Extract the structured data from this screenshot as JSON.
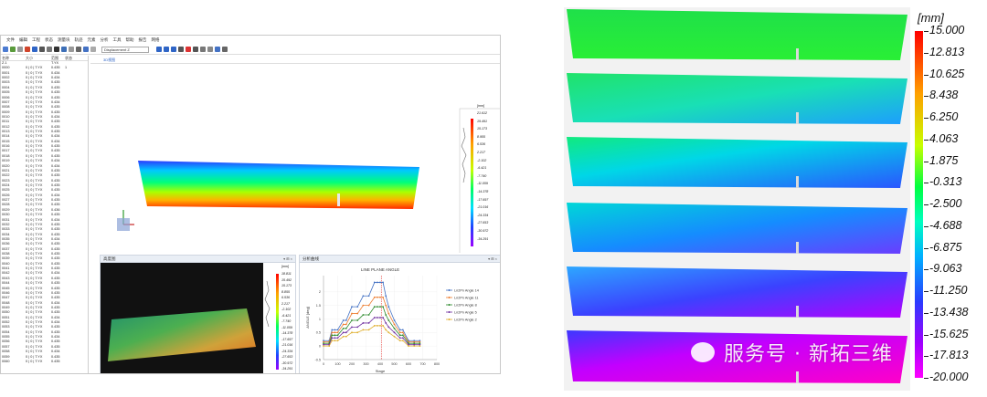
{
  "menu": [
    "文件",
    "编辑",
    "工程",
    "状态",
    "测量块",
    "轨迹",
    "元素",
    "分析",
    "工具",
    "帮助",
    "报告",
    "网络"
  ],
  "toolbar": {
    "display_mode": "Displacement Z"
  },
  "view_tab": "3D视图",
  "tree": {
    "headers": [
      "名称",
      "大小",
      "范围",
      "状态"
    ],
    "rows": [
      [
        "Z.1",
        "",
        "T.YX",
        ""
      ],
      [
        "0000",
        "0 | 0 | T.YX",
        "0.435",
        "1"
      ],
      [
        "0001",
        "0 | 0 | T.YX",
        "0.434",
        ""
      ],
      [
        "0002",
        "0 | 0 | T.YX",
        "0.434",
        ""
      ],
      [
        "0003",
        "0 | 0 | T.YX",
        "0.435",
        ""
      ],
      [
        "0004",
        "0 | 0 | T.YX",
        "0.435",
        ""
      ],
      [
        "0005",
        "0 | 0 | T.YX",
        "0.435",
        ""
      ],
      [
        "0006",
        "0 | 0 | T.YX",
        "0.435",
        ""
      ],
      [
        "0007",
        "0 | 0 | T.YX",
        "0.434",
        ""
      ],
      [
        "0008",
        "0 | 0 | T.YX",
        "0.435",
        ""
      ],
      [
        "0009",
        "0 | 0 | T.YX",
        "0.435",
        ""
      ],
      [
        "0010",
        "0 | 0 | T.YX",
        "0.434",
        ""
      ],
      [
        "0011",
        "0 | 0 | T.YX",
        "0.435",
        ""
      ],
      [
        "0012",
        "0 | 0 | T.YX",
        "0.435",
        ""
      ],
      [
        "0013",
        "0 | 0 | T.YX",
        "0.435",
        ""
      ],
      [
        "0014",
        "0 | 0 | T.YX",
        "0.434",
        ""
      ],
      [
        "0015",
        "0 | 0 | T.YX",
        "0.434",
        ""
      ],
      [
        "0016",
        "0 | 0 | T.YX",
        "0.435",
        ""
      ],
      [
        "0017",
        "0 | 0 | T.YX",
        "0.435",
        ""
      ],
      [
        "0018",
        "0 | 0 | T.YX",
        "0.435",
        ""
      ],
      [
        "0019",
        "0 | 0 | T.YX",
        "0.434",
        ""
      ],
      [
        "0020",
        "0 | 0 | T.YX",
        "0.434",
        ""
      ],
      [
        "0021",
        "0 | 0 | T.YX",
        "0.435",
        ""
      ],
      [
        "0022",
        "0 | 0 | T.YX",
        "0.435",
        ""
      ],
      [
        "0023",
        "0 | 0 | T.YX",
        "0.435",
        ""
      ],
      [
        "0024",
        "0 | 0 | T.YX",
        "0.435",
        ""
      ],
      [
        "0025",
        "0 | 0 | T.YX",
        "0.435",
        ""
      ],
      [
        "0026",
        "0 | 0 | T.YX",
        "0.434",
        ""
      ],
      [
        "0027",
        "0 | 0 | T.YX",
        "0.435",
        ""
      ],
      [
        "0028",
        "0 | 0 | T.YX",
        "0.435",
        ""
      ],
      [
        "0029",
        "0 | 0 | T.YX",
        "0.436",
        ""
      ],
      [
        "0030",
        "0 | 0 | T.YX",
        "0.435",
        ""
      ],
      [
        "0031",
        "0 | 0 | T.YX",
        "0.434",
        ""
      ],
      [
        "0032",
        "0 | 0 | T.YX",
        "0.435",
        ""
      ],
      [
        "0033",
        "0 | 0 | T.YX",
        "0.435",
        ""
      ],
      [
        "0034",
        "0 | 0 | T.YX",
        "0.435",
        ""
      ],
      [
        "0035",
        "0 | 0 | T.YX",
        "0.434",
        ""
      ],
      [
        "0036",
        "0 | 0 | T.YX",
        "0.435",
        ""
      ],
      [
        "0037",
        "0 | 0 | T.YX",
        "0.435",
        ""
      ],
      [
        "0038",
        "0 | 0 | T.YX",
        "0.435",
        ""
      ],
      [
        "0039",
        "0 | 0 | T.YX",
        "0.435",
        ""
      ],
      [
        "0040",
        "0 | 0 | T.YX",
        "0.435",
        ""
      ],
      [
        "0041",
        "0 | 0 | T.YX",
        "0.435",
        ""
      ],
      [
        "0042",
        "0 | 0 | T.YX",
        "0.434",
        ""
      ],
      [
        "0043",
        "0 | 0 | T.YX",
        "0.435",
        ""
      ],
      [
        "0044",
        "0 | 0 | T.YX",
        "0.435",
        ""
      ],
      [
        "0045",
        "0 | 0 | T.YX",
        "0.435",
        ""
      ],
      [
        "0046",
        "0 | 0 | T.YX",
        "0.435",
        ""
      ],
      [
        "0047",
        "0 | 0 | T.YX",
        "0.435",
        ""
      ],
      [
        "0048",
        "0 | 0 | T.YX",
        "0.434",
        ""
      ],
      [
        "0049",
        "0 | 0 | T.YX",
        "0.435",
        ""
      ],
      [
        "0050",
        "0 | 0 | T.YX",
        "0.435",
        ""
      ],
      [
        "0051",
        "0 | 0 | T.YX",
        "0.434",
        ""
      ],
      [
        "0052",
        "0 | 0 | T.YX",
        "0.434",
        ""
      ],
      [
        "0053",
        "0 | 0 | T.YX",
        "0.435",
        ""
      ],
      [
        "0054",
        "0 | 0 | T.YX",
        "0.435",
        ""
      ],
      [
        "0055",
        "0 | 0 | T.YX",
        "0.434",
        ""
      ],
      [
        "0056",
        "0 | 0 | T.YX",
        "0.435",
        ""
      ],
      [
        "0057",
        "0 | 0 | T.YX",
        "0.435",
        ""
      ],
      [
        "0058",
        "0 | 0 | T.YX",
        "0.434",
        ""
      ],
      [
        "0059",
        "0 | 0 | T.YX",
        "0.435",
        ""
      ],
      [
        "0060",
        "0 | 0 | T.YX",
        "0.435",
        ""
      ]
    ]
  },
  "view_legend": {
    "unit": "[mm]",
    "ticks": [
      "21.612",
      "19.491",
      "15.173",
      "8.955",
      "6.536",
      "2.217",
      "-2.102",
      "-6.421",
      "-7.740",
      "-11.059",
      "-14.378",
      "-17.697",
      "-21.016",
      "-24.334",
      "-27.653",
      "-30.972",
      "-34.291"
    ]
  },
  "heightmap_panel": {
    "title": "高度图",
    "unit": "[mm]",
    "ticks": [
      "18.811",
      "15.492",
      "15.173",
      "8.855",
      "6.536",
      "2.217",
      "-2.102",
      "-6.421",
      "-7.740",
      "-11.059",
      "-14.378",
      "-17.697",
      "-21.016",
      "-24.334",
      "-27.653",
      "-30.972",
      "-34.291"
    ]
  },
  "chart_panel": {
    "title": "分析曲线"
  },
  "chart_data": {
    "type": "line",
    "title": "LINE PLANE ANGLE",
    "xlabel": "Stage",
    "ylabel": "ANGLE [deg]",
    "xlim": [
      0,
      800
    ],
    "ylim": [
      -0.5,
      2.6
    ],
    "xticks": [
      0,
      100,
      200,
      300,
      400,
      500,
      600,
      700,
      800
    ],
    "yticks": [
      -0.5,
      0,
      0.5,
      1,
      1.5,
      2
    ],
    "x": [
      0,
      40,
      60,
      80,
      100,
      140,
      160,
      200,
      240,
      280,
      320,
      360,
      380,
      400,
      420,
      440,
      460,
      500,
      540,
      560,
      600,
      640,
      680
    ],
    "series": [
      {
        "name": "Ln2Pn Angle 14",
        "color": "#4472c4",
        "values": [
          0.2,
          0.2,
          0.6,
          0.6,
          0.6,
          0.95,
          0.95,
          1.45,
          1.45,
          1.85,
          1.85,
          2.35,
          2.35,
          2.35,
          2.35,
          1.85,
          1.45,
          0.95,
          0.6,
          0.6,
          0.2,
          0.2,
          0.2
        ]
      },
      {
        "name": "Ln2Pn Angle 11",
        "color": "#ed7d31",
        "values": [
          0.15,
          0.15,
          0.5,
          0.5,
          0.5,
          0.8,
          0.8,
          1.2,
          1.2,
          1.5,
          1.5,
          1.8,
          1.8,
          1.8,
          1.8,
          1.5,
          1.2,
          0.8,
          0.5,
          0.5,
          0.15,
          0.15,
          0.15
        ]
      },
      {
        "name": "Ln2Pn Angle 8",
        "color": "#2e8b2e",
        "values": [
          0.1,
          0.1,
          0.4,
          0.4,
          0.4,
          0.65,
          0.65,
          0.95,
          0.95,
          1.15,
          1.15,
          1.45,
          1.45,
          1.45,
          1.45,
          1.15,
          0.95,
          0.65,
          0.4,
          0.4,
          0.1,
          0.1,
          0.1
        ]
      },
      {
        "name": "Ln2Pn Angle 5",
        "color": "#7030a0",
        "values": [
          0.05,
          0.05,
          0.3,
          0.3,
          0.3,
          0.5,
          0.5,
          0.7,
          0.7,
          0.85,
          0.85,
          1.05,
          1.05,
          1.05,
          1.05,
          0.85,
          0.7,
          0.5,
          0.3,
          0.3,
          0.05,
          0.05,
          0.05
        ]
      },
      {
        "name": "Ln2Pn Angle 2",
        "color": "#e0b030",
        "values": [
          0.0,
          0.0,
          0.2,
          0.2,
          0.2,
          0.35,
          0.35,
          0.5,
          0.5,
          0.6,
          0.6,
          0.75,
          0.75,
          0.75,
          0.75,
          0.6,
          0.5,
          0.35,
          0.2,
          0.2,
          0.0,
          0.0,
          0.0
        ]
      }
    ],
    "marker_x": 410,
    "legend": "right"
  },
  "big_legend": {
    "unit": "[mm]",
    "ticks": [
      "15.000",
      "12.813",
      "10.625",
      "8.438",
      "6.250",
      "4.063",
      "1.875",
      "-0.313",
      "-2.500",
      "-4.688",
      "-6.875",
      "-9.063",
      "-11.250",
      "-13.438",
      "-15.625",
      "-17.813",
      "-20.000"
    ]
  },
  "watermark": "服务号 · 新拓三维",
  "colors": {
    "accent": "#2f65c6",
    "panel_bg": "#e9eef5"
  }
}
